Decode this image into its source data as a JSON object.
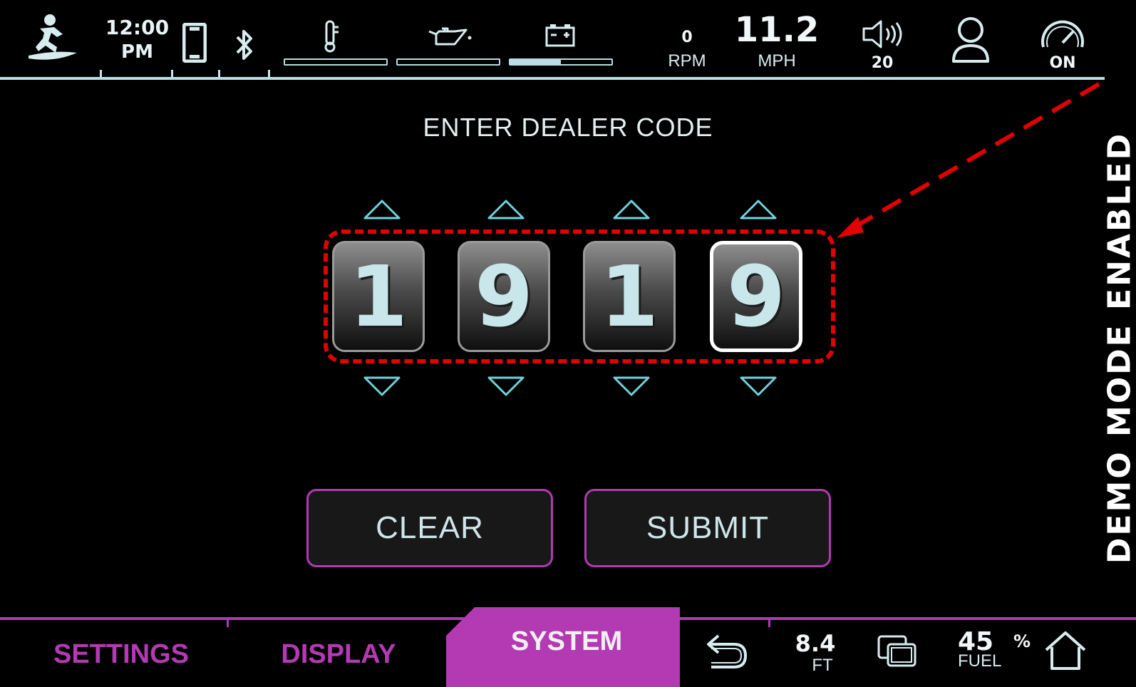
{
  "status_bar": {
    "time": "12:00",
    "ampm": "PM",
    "rpm_value": "0",
    "rpm_label": "RPM",
    "speed_value": "11.2",
    "speed_unit": "MPH",
    "volume_value": "20",
    "cruise_state": "ON",
    "gauges": {
      "temperature_level": 0.0,
      "oil_level": 0.0,
      "battery_level": 0.5
    },
    "icons": [
      "surfer-icon",
      "phone-icon",
      "bluetooth-icon",
      "thermometer-icon",
      "oil-can-icon",
      "battery-icon",
      "speaker-icon",
      "user-icon",
      "speedometer-icon"
    ]
  },
  "main": {
    "title": "ENTER DEALER CODE",
    "digits": [
      "1",
      "9",
      "1",
      "9"
    ],
    "selected_digit_index": 3,
    "clear_label": "CLEAR",
    "submit_label": "SUBMIT"
  },
  "side_banner": {
    "text": "DEMO MODE ENABLED"
  },
  "bottom_nav": {
    "tabs": [
      "SETTINGS",
      "DISPLAY",
      "SYSTEM"
    ],
    "active_tab": "SYSTEM",
    "depth_value": "8.4",
    "depth_unit": "FT",
    "fuel_value": "45",
    "fuel_percent": "%",
    "fuel_label": "FUEL",
    "icons": [
      "back-icon",
      "screens-icon",
      "home-icon"
    ]
  },
  "colors": {
    "accent": "#b33ab3",
    "highlight": "#e30000",
    "light_teal": "#b9dde2",
    "background": "#000000"
  }
}
